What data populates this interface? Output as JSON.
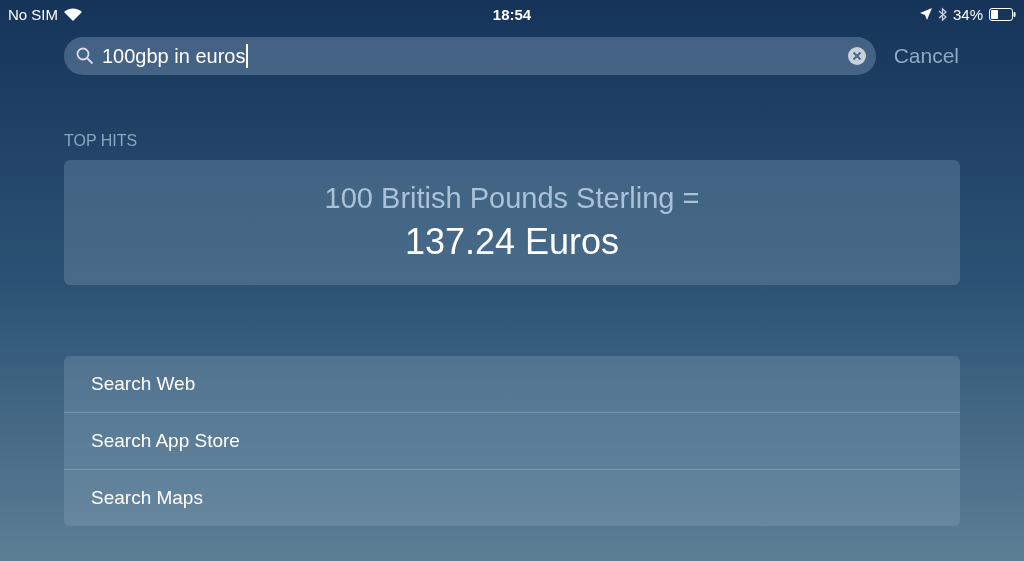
{
  "status_bar": {
    "carrier": "No SIM",
    "time": "18:54",
    "battery": "34%"
  },
  "search": {
    "value": "100gbp in euros",
    "cancel": "Cancel"
  },
  "top_hits": {
    "heading": "TOP HITS",
    "conversion": "100 British Pounds Sterling =",
    "result": "137.24 Euros"
  },
  "suggestions": [
    {
      "label": "Search Web"
    },
    {
      "label": "Search App Store"
    },
    {
      "label": "Search Maps"
    }
  ]
}
